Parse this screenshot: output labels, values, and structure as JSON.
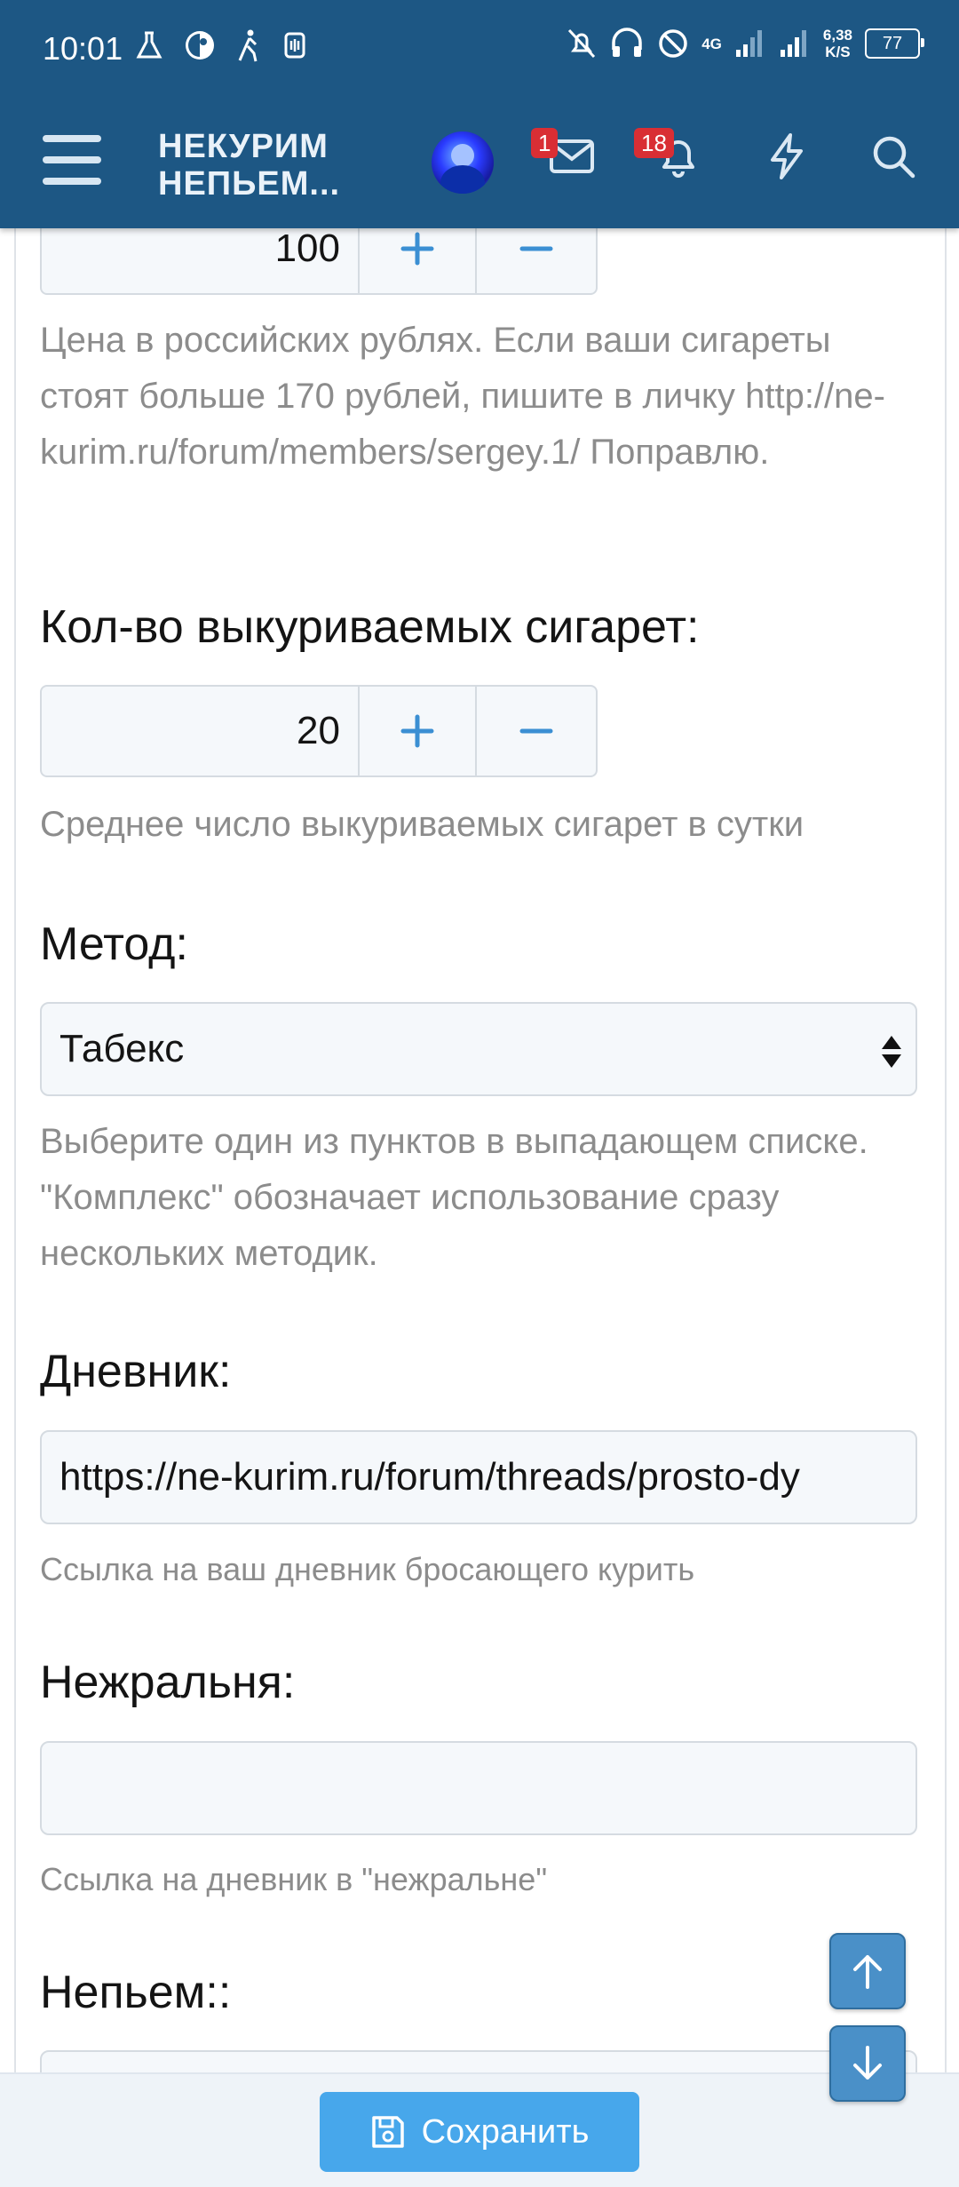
{
  "status_bar": {
    "time": "10:01",
    "network": "4G",
    "speed_value": "6,38",
    "speed_unit": "K/S",
    "battery": "77"
  },
  "app_bar": {
    "logo_line1": "НЕКУРИМ",
    "logo_line2": "НЕПЬЕМ...",
    "messages_badge": "1",
    "alerts_badge": "18"
  },
  "form": {
    "price": {
      "value": "100",
      "plus": "+",
      "minus": "−",
      "hint": "Цена в российских рублях. Если ваши сигареты стоят больше 170 рублей, пишите в личку http://ne-kurim.ru/forum/members/sergey.1/ Поправлю."
    },
    "cigarettes": {
      "label": "Кол-во выкуриваемых сигарет:",
      "value": "20",
      "plus": "+",
      "minus": "−",
      "hint": "Среднее число выкуриваемых сигарет в сутки"
    },
    "method": {
      "label": "Метод:",
      "selected": "Табекс",
      "hint": "Выберите один из пунктов в выпадающем списке. \"Комплекс\" обозначает использование сразу нескольких методик."
    },
    "diary": {
      "label": "Дневник:",
      "value": "https://ne-kurim.ru/forum/threads/prosto-dy",
      "hint": "Ссылка на ваш дневник бросающего курить"
    },
    "nezhralnya": {
      "label": "Нежральня:",
      "value": "",
      "hint": "Ссылка на дневник в \"нежральне\""
    },
    "nepem": {
      "label": "Непьем::"
    }
  },
  "save_button": {
    "label": "Сохранить"
  },
  "colors": {
    "header": "#1d5784",
    "accent": "#47a7eb",
    "badge": "#d92e34",
    "hint_text": "#8c8c8c"
  }
}
